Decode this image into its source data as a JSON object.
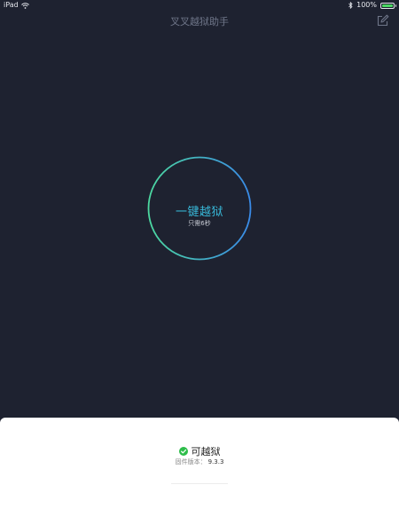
{
  "status_bar": {
    "device": "iPad",
    "battery_percent": "100%",
    "battery_level": 1.0,
    "icons": [
      "wifi-icon",
      "bluetooth-icon",
      "battery-icon"
    ]
  },
  "header": {
    "title": "叉叉越狱助手",
    "edit_icon": "edit-icon"
  },
  "main": {
    "jailbreak_button_label": "一键越狱",
    "jailbreak_button_sub": "只需6秒"
  },
  "bottom_panel": {
    "status_icon": "check-circle-icon",
    "status_text": "可越狱",
    "firmware_label": "固件版本：",
    "firmware_version": "9.3.3"
  },
  "colors": {
    "background": "#1e2230",
    "accent": "#38b8d8",
    "ring_gradient_start": "#4cd9a0",
    "ring_gradient_end": "#3a8be8",
    "success": "#2dbd4a",
    "battery": "#4cd964"
  }
}
